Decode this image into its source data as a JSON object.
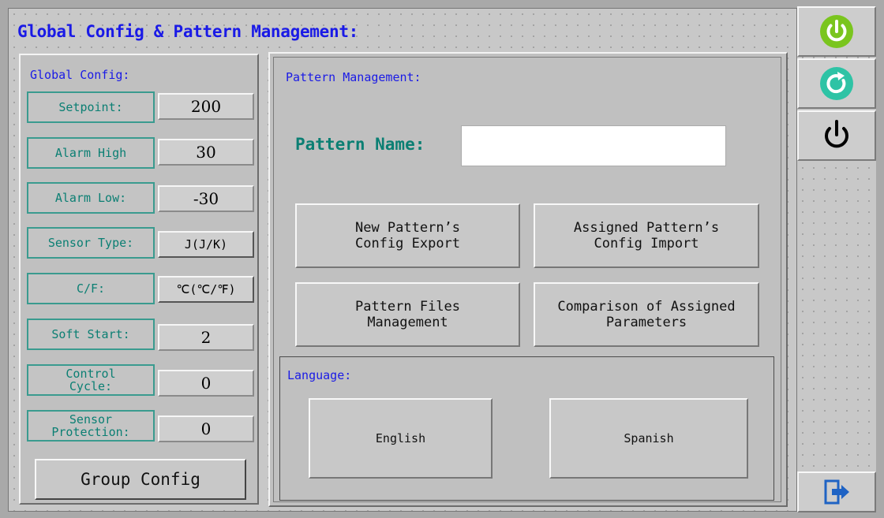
{
  "header": {
    "title": "Global Config & Pattern Management:"
  },
  "global_config": {
    "heading": "Global Config:",
    "rows": [
      {
        "label": "Setpoint:",
        "value": "200"
      },
      {
        "label": "Alarm High",
        "value": "30"
      },
      {
        "label": "Alarm Low:",
        "value": "-30"
      },
      {
        "label": "Sensor Type:",
        "value": "J(J/K)"
      },
      {
        "label": "C/F:",
        "value": "℃(℃/℉)"
      },
      {
        "label": "Soft Start:",
        "value": "2"
      },
      {
        "label": "Control Cycle:",
        "value": "0"
      },
      {
        "label": "Sensor Protection:",
        "value": "0"
      }
    ],
    "group_config_button": "Group Config"
  },
  "pattern_management": {
    "heading": "Pattern Management:",
    "pattern_name_label": "Pattern Name:",
    "pattern_name_value": "",
    "buttons": {
      "new_export": "New Pattern’s Config Export",
      "assigned_import": "Assigned Pattern’s Config Import",
      "files_management": "Pattern Files Management",
      "comparison": "Comparison of Assigned Parameters"
    }
  },
  "language": {
    "heading": "Language:",
    "english": "English",
    "spanish": "Spanish"
  },
  "colors": {
    "title_blue": "#1a1ae6",
    "label_teal": "#0b7f73",
    "power_green": "#7ac51e",
    "refresh_teal": "#2ec3a5",
    "exit_blue": "#1f63c4"
  },
  "side_icons": [
    "power-green-icon",
    "refresh-icon",
    "power-black-icon",
    "exit-icon"
  ]
}
